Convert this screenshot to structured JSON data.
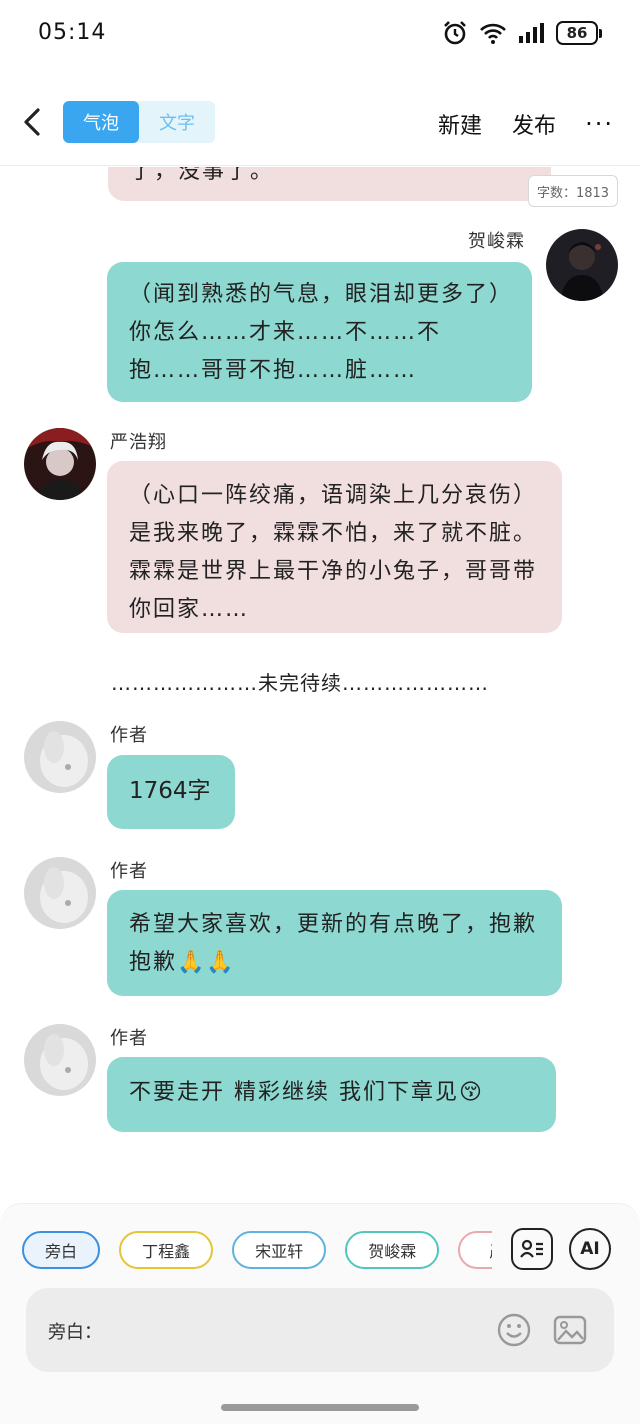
{
  "status_bar": {
    "time": "05:14",
    "battery": "86",
    "icons": [
      "alarm-icon",
      "wifi-6-icon",
      "signal-icon",
      "battery-icon"
    ]
  },
  "header": {
    "tabs": [
      {
        "label": "气泡",
        "active": true
      },
      {
        "label": "文字",
        "active": false
      }
    ],
    "new_label": "新建",
    "publish_label": "发布",
    "more_label": "···"
  },
  "word_count": "字数：1813",
  "messages": [
    {
      "speaker": "",
      "side": "left",
      "color": "pink",
      "text": "了，没事了。"
    },
    {
      "speaker": "贺峻霖",
      "side": "right",
      "color": "teal",
      "text": "（闻到熟悉的气息，眼泪却更多了）你怎么……才来……不……不抱……哥哥不抱……脏……"
    },
    {
      "speaker": "严浩翔",
      "side": "left",
      "color": "pink",
      "text": "（心口一阵绞痛，语调染上几分哀伤）是我来晚了，霖霖不怕，来了就不脏。霖霖是世界上最干净的小兔子，哥哥带你回家……"
    },
    {
      "speaker": "作者",
      "side": "left",
      "color": "teal",
      "text": "1764字"
    },
    {
      "speaker": "作者",
      "side": "left",
      "color": "teal",
      "text": "希望大家喜欢，更新的有点晚了，抱歉抱歉🙏🙏"
    },
    {
      "speaker": "作者",
      "side": "left",
      "color": "teal",
      "text": "不要走开 精彩继续 我们下章见😚"
    }
  ],
  "divider": "…………………未完待续…………………",
  "bottom": {
    "chips": [
      {
        "label": "旁白",
        "border": "#3a8fe0",
        "selected": true
      },
      {
        "label": "丁程鑫",
        "border": "#e6c437",
        "selected": false
      },
      {
        "label": "宋亚轩",
        "border": "#5fb2e0",
        "selected": false
      },
      {
        "label": "贺峻霖",
        "border": "#52c6be",
        "selected": false
      },
      {
        "label": "严浩",
        "border": "#e8a9ad",
        "selected": false
      }
    ],
    "ai_label": "AI",
    "input_label": "旁白："
  }
}
